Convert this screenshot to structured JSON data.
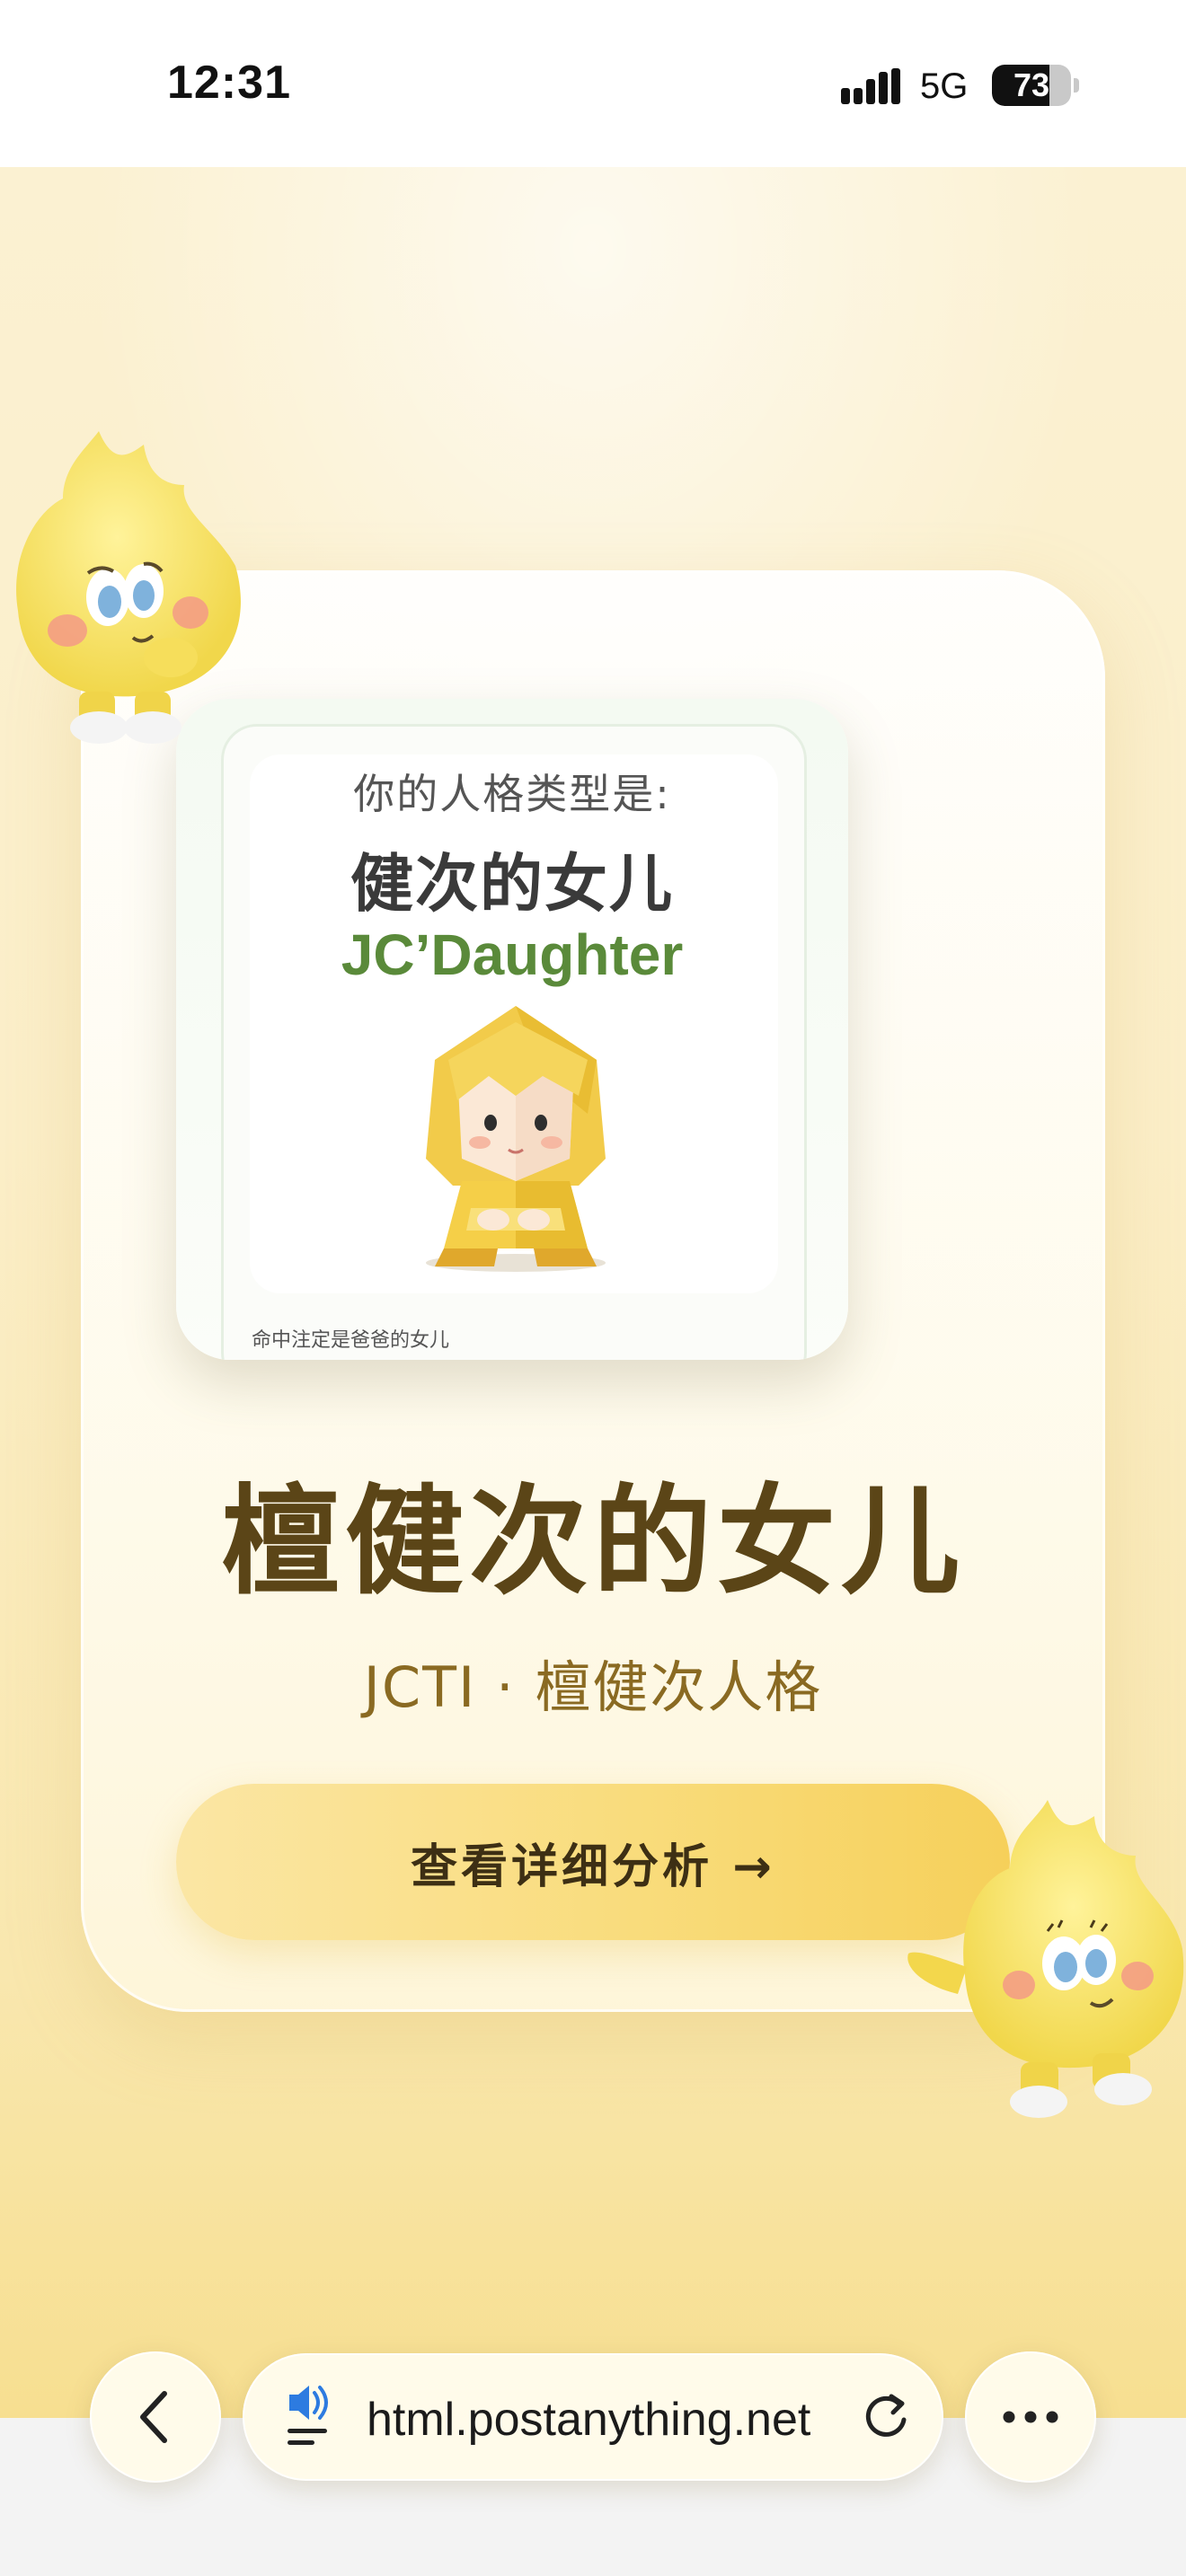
{
  "status_bar": {
    "time": "12:31",
    "network": "5G",
    "battery_level": "73",
    "battery_percent": 73
  },
  "poster": {
    "prompt": "你的人格类型是:",
    "title_cn": "健次的女儿",
    "title_en": "JC’Daughter",
    "caption": "命中注定是爸爸的女儿",
    "figure_icon": "origami-girl-figure"
  },
  "result": {
    "title": "檀健次的女儿",
    "subtitle": "JCTI · 檀健次人格",
    "detail_button_label": "查看详细分析 →"
  },
  "browser": {
    "url": "html.postanything.net",
    "back_icon": "chevron-left-icon",
    "reader_icon": "reader-speaker-icon",
    "reload_icon": "reload-icon",
    "more_icon": "more-dots-icon"
  },
  "colors": {
    "accent_gold": "#f9dc7c",
    "title_brown": "#5b4517",
    "en_green": "#5a8a3a"
  }
}
